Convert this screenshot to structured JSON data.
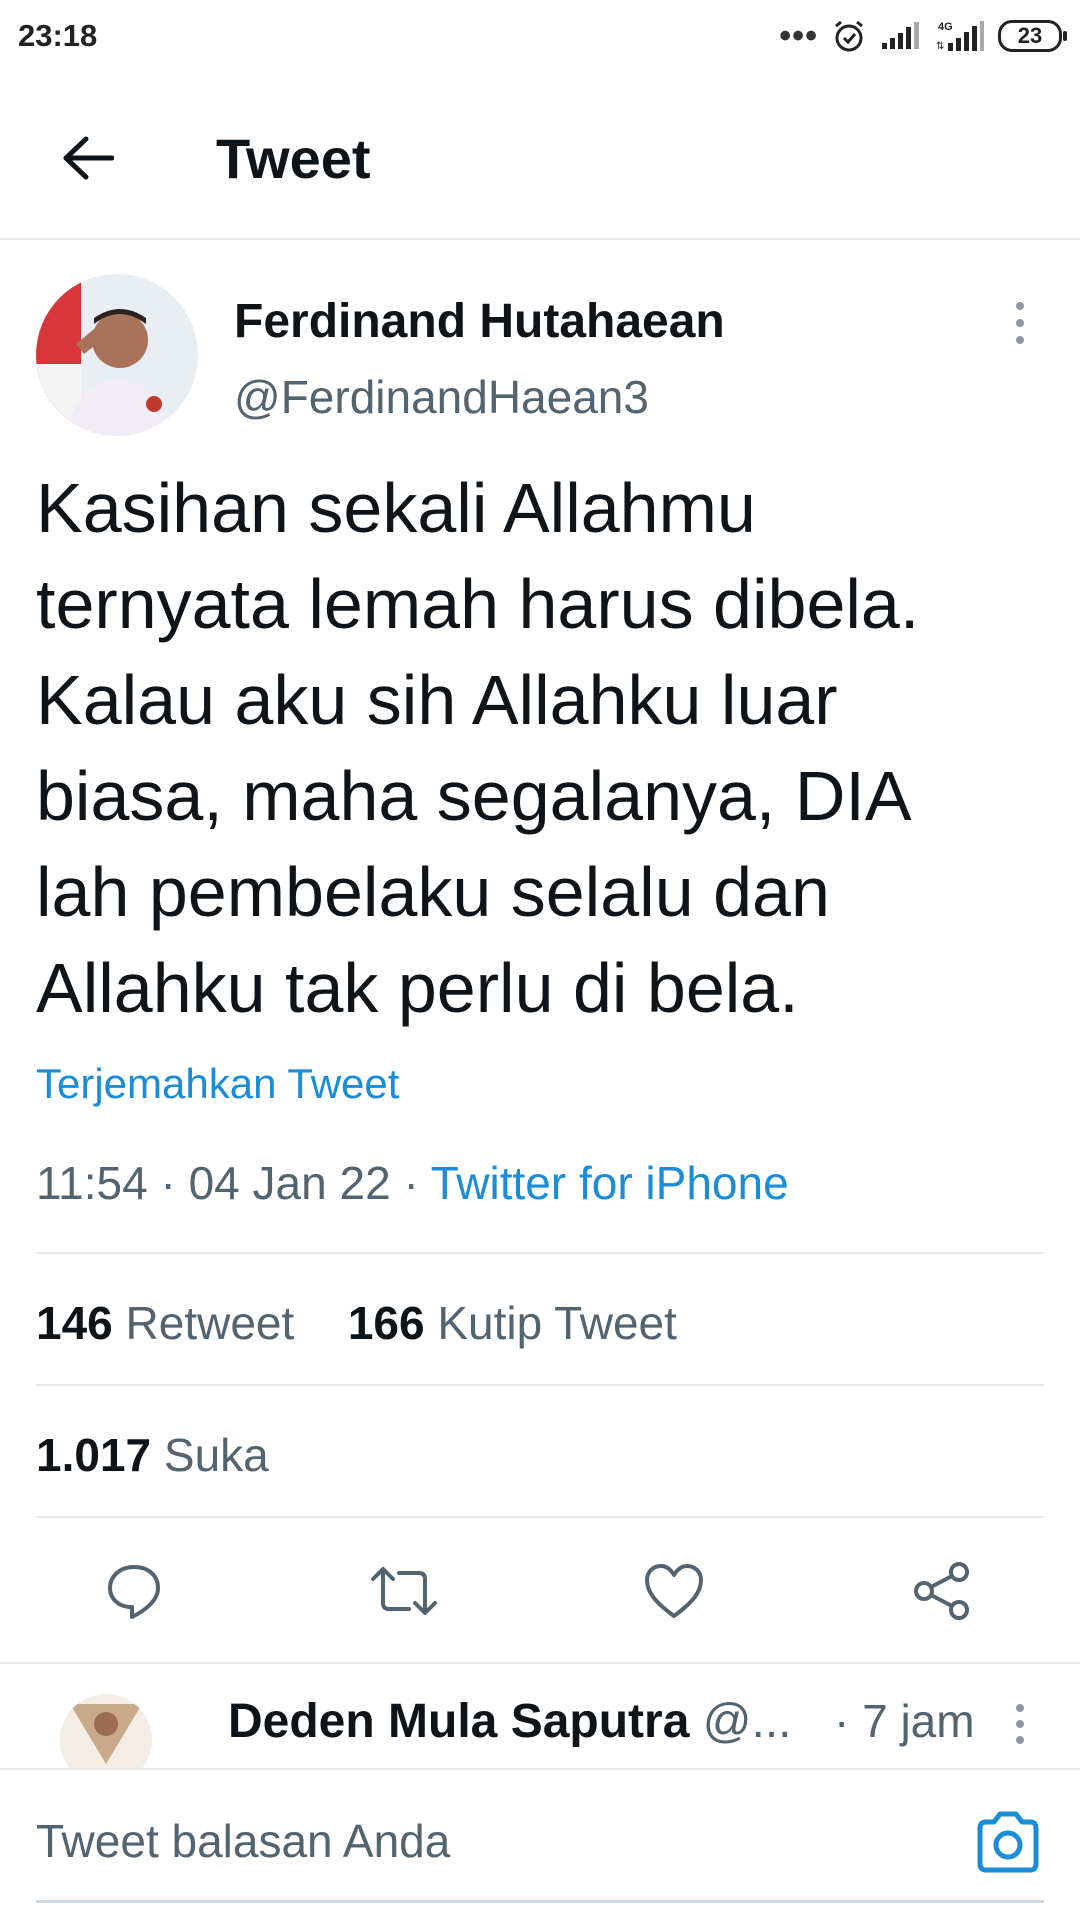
{
  "status_bar": {
    "time": "23:18",
    "battery": "23",
    "icons": [
      "more-dots-icon",
      "alarm-icon",
      "signal-icon",
      "4g-signal-icon",
      "battery-icon"
    ]
  },
  "header": {
    "title": "Tweet",
    "back_icon": "arrow-left-icon"
  },
  "tweet": {
    "author_name": "Ferdinand Hutahaean",
    "author_handle": "@FerdinandHaean3",
    "text_lines": [
      "Kasihan sekali Allahmu",
      "ternyata lemah harus dibela.",
      "Kalau aku sih Allahku luar",
      "biasa, maha segalanya, DIA",
      "lah pembelaku selalu dan",
      "Allahku tak perlu di bela."
    ],
    "translate": "Terjemahkan Tweet",
    "time": "11:54",
    "separator": "·",
    "date": "04 Jan 22",
    "source": "Twitter for iPhone"
  },
  "stats": {
    "retweets_count": "146",
    "retweets_label": "Retweet",
    "quotes_count": "166",
    "quotes_label": "Kutip Tweet",
    "likes_count": "1.017",
    "likes_label": "Suka"
  },
  "actions": [
    "reply-icon",
    "retweet-icon",
    "like-icon",
    "share-icon"
  ],
  "reply_preview": {
    "name": "Deden Mula Saputra",
    "handle": "@...",
    "time": "· 7 jam"
  },
  "compose": {
    "placeholder": "Tweet balasan Anda",
    "camera_icon": "camera-icon"
  },
  "colors": {
    "link": "#1a8cd8",
    "text": "#0f1419",
    "secondary": "#536471",
    "divider": "#e7e9eb"
  }
}
